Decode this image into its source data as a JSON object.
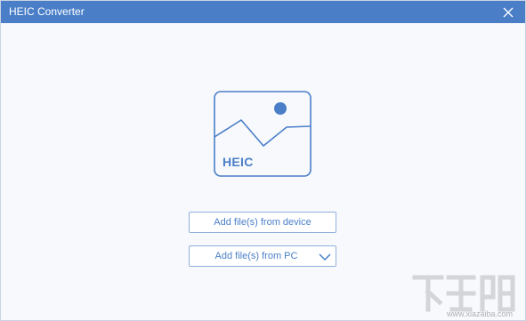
{
  "window": {
    "title": "HEIC Converter"
  },
  "icons": {
    "close": "close-icon",
    "image_placeholder": "image-icon",
    "chevron": "chevron-down-icon"
  },
  "illustration": {
    "label": "HEIC"
  },
  "actions": {
    "add_from_device": "Add file(s) from device",
    "add_from_pc": "Add file(s) from PC"
  },
  "watermark": {
    "site": "www.xiazaiba.com"
  },
  "colors": {
    "titlebar": "#4a7fc8",
    "accent": "#4a7fc8",
    "button_border": "#8fb0dc",
    "background": "#f8f9fd"
  }
}
